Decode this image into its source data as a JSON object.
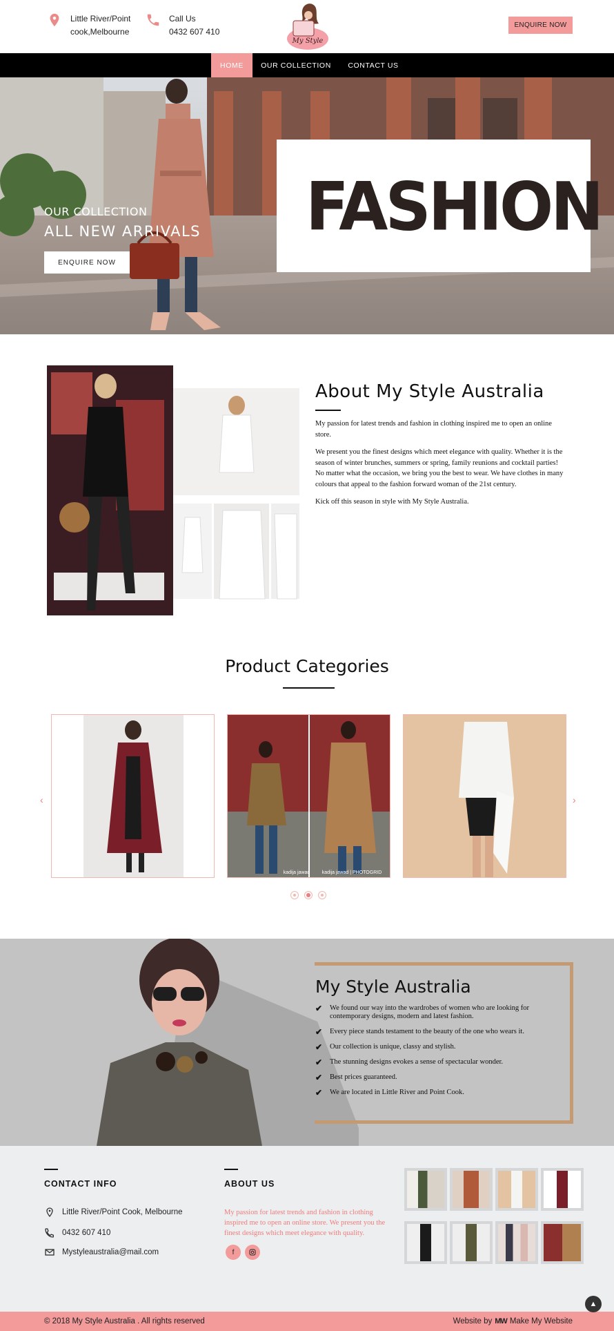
{
  "header": {
    "address_line1": "Little River/Point",
    "address_line2": "cook,Melbourne",
    "call_label": "Call Us",
    "phone": "0432 607 410",
    "logo_text": "My Style",
    "enquire_label": "ENQUIRE NOW"
  },
  "nav": {
    "items": [
      "HOME",
      "OUR COLLECTION",
      "CONTACT US"
    ],
    "active": "HOME"
  },
  "hero": {
    "kicker": "OUR COLLECTION",
    "title": "ALL NEW ARRIVALS",
    "button_label": "ENQUIRE NOW",
    "card_word": "FASHION"
  },
  "about": {
    "title": "About My Style Australia",
    "paragraphs": [
      "My passion for latest trends and fashion in clothing inspired me to open an online store.",
      "We present you the finest designs which meet elegance with quality. Whether it is the season of winter brunches, summers or spring, family reunions and cocktail parties! No matter what the occasion, we bring you the best to wear. We have clothes in many colours that appeal to the fashion forward woman of the 21st century.",
      "Kick off this season in style with My Style Australia."
    ]
  },
  "categories": {
    "title": "Product Categories",
    "prev_icon": "chevron-left-icon",
    "next_icon": "chevron-right-icon",
    "slides": 3,
    "active_slide": 2,
    "card_captions": [
      "kadija jawad",
      "kadija jawad | PHOTOGRID"
    ]
  },
  "feature": {
    "title": "My Style Australia",
    "points": [
      "We found our way into the wardrobes of women who are looking for contemporary designs, modern and latest fashion.",
      "Every piece stands testament to the beauty of the one who wears it.",
      "Our collection is unique, classy and stylish.",
      "The stunning designs evokes a sense of spectacular wonder.",
      "Best prices guaranteed.",
      "We are located in Little River and Point Cook."
    ]
  },
  "footer": {
    "contact_heading": "CONTACT INFO",
    "address": "Little River/Point Cook, Melbourne",
    "phone": "0432 607 410",
    "email": "Mystyleaustralia@mail.com",
    "about_heading": "ABOUT US",
    "about_text": "My passion for latest trends and fashion in clothing inspired me to open an online store. We present you the finest designs which meet elegance with quality.",
    "social_icons": [
      "facebook-icon",
      "instagram-icon"
    ],
    "copyright": "© 2018 My Style Australia . All rights reserved",
    "credit_prefix": "Website by",
    "credit_mark": "MW",
    "credit_name": "Make My Website"
  },
  "colors": {
    "accent": "#f39a9a",
    "accent_text": "#f07c7c",
    "nav_bg": "#000000",
    "frame": "#c49a72",
    "band_bg": "#c3c3c3",
    "footer_bg": "#eceeef"
  }
}
